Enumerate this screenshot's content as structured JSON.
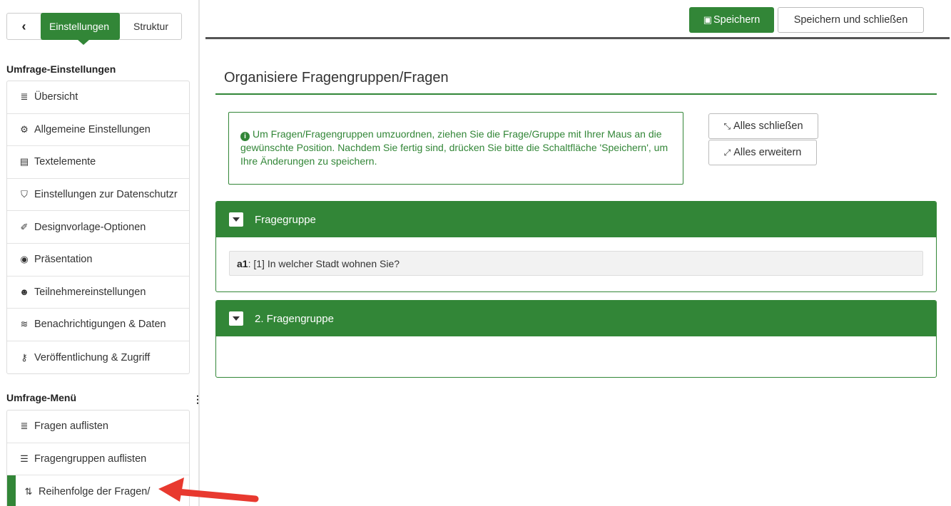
{
  "sidebar": {
    "back_symbol": "‹",
    "tab_settings": "Einstellungen",
    "tab_structure": "Struktur",
    "section_settings_title": "Umfrage-Einstellungen",
    "settings_items": [
      {
        "icon": "list-icon",
        "glyph": "≣",
        "label": "Übersicht"
      },
      {
        "icon": "gears-icon",
        "glyph": "⚙",
        "label": "Allgemeine Einstellungen"
      },
      {
        "icon": "document-icon",
        "glyph": "▤",
        "label": "Textelemente"
      },
      {
        "icon": "shield-icon",
        "glyph": "⛉",
        "label": "Einstellungen zur Datenschutzr"
      },
      {
        "icon": "brush-icon",
        "glyph": "✐",
        "label": "Designvorlage-Optionen"
      },
      {
        "icon": "eye-slash-icon",
        "glyph": "◉",
        "label": "Präsentation"
      },
      {
        "icon": "users-icon",
        "glyph": "☻",
        "label": "Teilnehmereinstellungen"
      },
      {
        "icon": "rss-icon",
        "glyph": "≋",
        "label": "Benachrichtigungen & Daten"
      },
      {
        "icon": "key-icon",
        "glyph": "⚷",
        "label": "Veröffentlichung & Zugriff"
      }
    ],
    "section_menu_title": "Umfrage-Menü",
    "menu_items": [
      {
        "icon": "list-icon",
        "glyph": "≣",
        "label": "Fragen auflisten"
      },
      {
        "icon": "list-bold-icon",
        "glyph": "☰",
        "label": "Fragengruppen auflisten"
      },
      {
        "icon": "reorder-icon",
        "glyph": "⇅",
        "label": "Reihenfolge der Fragen/"
      }
    ],
    "handle_symbol": "⋮"
  },
  "toolbar": {
    "save_icon": "floppy-icon",
    "save_glyph": "▣",
    "save_label": "Speichern",
    "save_close_label": "Speichern und schließen"
  },
  "main": {
    "title": "Organisiere Fragengruppen/Fragen",
    "info_icon": "i",
    "info_text": "Um Fragen/Fragengruppen umzuordnen, ziehen Sie die Frage/Gruppe mit Ihrer Maus an die gewünschte Position. Nachdem Sie fertig sind, drücken Sie bitte die Schaltfläche 'Speichern', um Ihre Änderungen zu speichern.",
    "collapse_all_glyph": "⤡",
    "collapse_all_label": "Alles schließen",
    "expand_all_glyph": "⤢",
    "expand_all_label": "Alles erweitern",
    "groups": [
      {
        "title": "Fragegruppe",
        "questions": [
          {
            "code": "a1",
            "text": ": [1] In welcher Stadt wohnen Sie?"
          }
        ]
      },
      {
        "title": "2. Fragengruppe",
        "questions": []
      }
    ]
  },
  "colors": {
    "accent": "#328637",
    "annotation_arrow": "#e8392f"
  }
}
